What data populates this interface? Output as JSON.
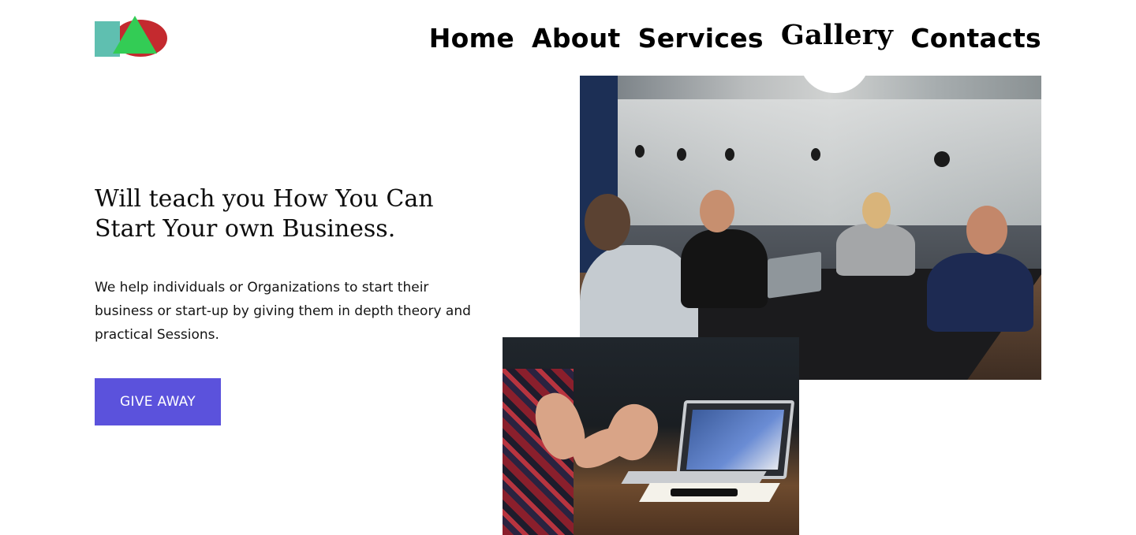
{
  "colors": {
    "logo_teal": "#5fbfb0",
    "logo_red": "#c42a2f",
    "logo_green": "#33cc55",
    "cta_bg": "#5b52dc"
  },
  "logo": {
    "shape_icons": [
      "square-icon",
      "ellipse-icon",
      "triangle-icon"
    ]
  },
  "nav": {
    "items": [
      {
        "label": "Home"
      },
      {
        "label": "About"
      },
      {
        "label": "Services"
      },
      {
        "label": "Gallery",
        "active": true
      },
      {
        "label": "Contacts"
      }
    ]
  },
  "hero": {
    "title": "Will teach you How You Can Start Your own Business.",
    "description": "We help individuals or Organizations to start their business or start-up by giving them in depth theory and practical Sessions.",
    "cta_label": "GIVE AWAY"
  },
  "images": {
    "meeting_photo": "people-meeting-around-table-photo",
    "laptop_photo": "hands-gesturing-over-laptop-photo"
  }
}
